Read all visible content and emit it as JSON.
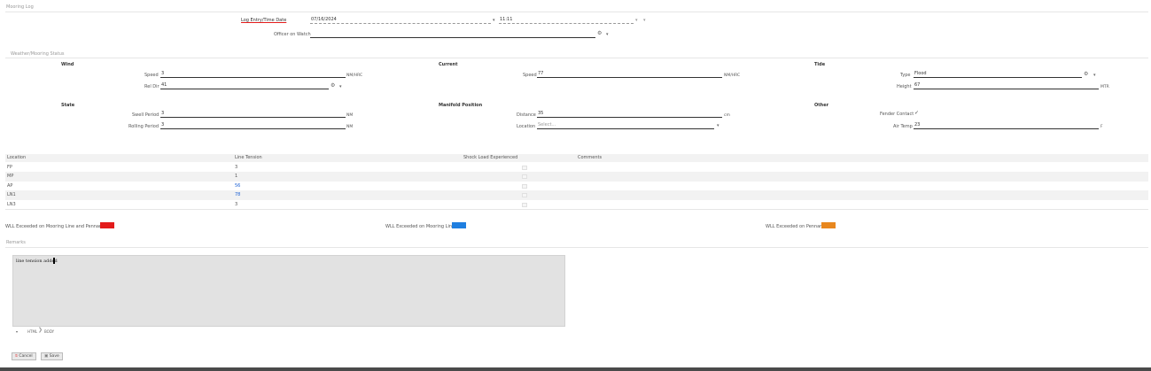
{
  "mooring_log": {
    "title": "Mooring Log",
    "log_entry_label": "Log Entry/Time Date",
    "date_value": "07/16/2024",
    "time_value": "11:11",
    "officer_label": "Officer on Watch",
    "officer_value": ""
  },
  "weather": {
    "section_title": "Weather/Mooring Status",
    "wind": {
      "heading": "Wind",
      "speed_label": "Speed",
      "speed_value": "3",
      "speed_unit": "NM/HRC",
      "rel_dir_label": "Rel Dir",
      "rel_dir_value": "41"
    },
    "current": {
      "heading": "Current",
      "speed_label": "Speed",
      "speed_value": "77",
      "speed_unit": "NM/HRC"
    },
    "tide": {
      "heading": "Tide",
      "type_label": "Type",
      "type_value": "Flood",
      "height_label": "Height",
      "height_value": "67",
      "height_unit": "MTR"
    },
    "state": {
      "heading": "State",
      "swell_label": "Swell Period",
      "swell_value": "3",
      "swell_unit": "NM",
      "rolling_label": "Rolling Period",
      "rolling_value": "3",
      "rolling_unit": "NM"
    },
    "manifold": {
      "heading": "Manifold Position",
      "distance_label": "Distance",
      "distance_value": "35",
      "distance_unit": "cm",
      "location_label": "Location",
      "location_placeholder": "Select..."
    },
    "other": {
      "heading": "Other",
      "fender_label": "Fender Contact",
      "fender_value": "✓",
      "air_temp_label": "Air Temp",
      "air_temp_value": "23",
      "air_temp_unit": "F"
    }
  },
  "table": {
    "columns": [
      "Location",
      "Line Tension",
      "Shock Load Experienced",
      "Comments"
    ],
    "rows": [
      {
        "location": "FP",
        "tension": "3"
      },
      {
        "location": "MP",
        "tension": "1"
      },
      {
        "location": "AP",
        "tension": "56"
      },
      {
        "location": "LN1",
        "tension": "78"
      },
      {
        "location": "LN3",
        "tension": "3"
      }
    ]
  },
  "legend": {
    "line_and_pennant": "WLL Exceeded on Mooring Line and Pennant",
    "line": "WLL Exceeded on Mooring Line",
    "pennant": "WLL Exceeded on Pennant",
    "color_red": "#e31b1b",
    "color_blue": "#1f7fe0",
    "color_orange": "#e8871e"
  },
  "remarks": {
    "title": "Remarks",
    "text": "line tension added",
    "path_html": "HTML",
    "path_body": "BODY"
  },
  "buttons": {
    "cancel": "Cancel",
    "save": "Save"
  },
  "icons": {
    "gear": "⚙",
    "caret": "▾",
    "cal": "▾",
    "clock": "◷",
    "chevron": "❯",
    "cancel": "⦸",
    "save": "▣"
  }
}
